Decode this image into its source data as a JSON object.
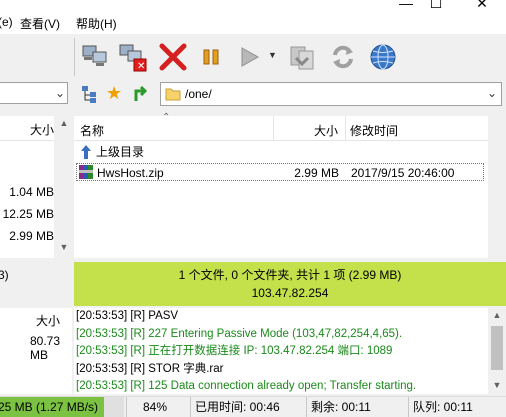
{
  "window": {
    "minimize": "—",
    "maximize": "☐",
    "close": "✕"
  },
  "menu": {
    "view": "查看(V)",
    "prev": "(e)",
    "help": "帮助(H)"
  },
  "address": {
    "path": "/one/"
  },
  "local": {
    "size_header": "大小",
    "sizes": [
      "1.04 MB",
      "12.25 MB",
      "2.99 MB"
    ],
    "status": "3)"
  },
  "remote": {
    "col_name": "名称",
    "col_size": "大小",
    "col_modified": "修改时间",
    "parent_dir": "上级目录",
    "files": [
      {
        "name": "HwsHost.zip",
        "size": "2.99 MB",
        "modified": "2017/9/15 20:46:00"
      }
    ],
    "status_line1": "1 个文件, 0 个文件夹, 共计 1 项 (2.99 MB)",
    "status_line2": "103.47.82.254"
  },
  "queue": {
    "size_header": "大小",
    "size_value": "80.73 MB"
  },
  "log": [
    {
      "time": "[20:53:53]",
      "tag": "[R]",
      "text": "PASV",
      "color": "#000000"
    },
    {
      "time": "[20:53:53]",
      "tag": "[R]",
      "text": "227 Entering Passive Mode (103,47,82,254,4,65).",
      "color": "#1a8a1a"
    },
    {
      "time": "[20:53:53]",
      "tag": "[R]",
      "text": "正在打开数据连接 IP: 103.47.82.254 端口: 1089",
      "color": "#1a8a1a"
    },
    {
      "time": "[20:53:53]",
      "tag": "[R]",
      "text": "STOR 字典.rar",
      "color": "#000000"
    },
    {
      "time": "[20:53:53]",
      "tag": "[R]",
      "text": "125 Data connection already open; Transfer starting.",
      "color": "#1a8a1a"
    }
  ],
  "statusbar": {
    "transfer": "25 MB (1.27 MB/s)",
    "percent": "84%",
    "progress": 0.84,
    "elapsed": "已用时间: 00:46",
    "remaining": "剩余: 00:11",
    "queue": "队列: 00:11"
  },
  "colors": {
    "green_bar": "#c4e04a",
    "log_green": "#1a8a1a",
    "progress_green": "#7cc242"
  },
  "icons": {
    "connect": "computers-icon",
    "disconnect": "disconnect-icon",
    "stop": "red-x-icon",
    "pause": "pause-icon",
    "play": "play-icon",
    "reconnect": "reconnect-icon",
    "refresh": "refresh-icon",
    "web": "globe-icon",
    "tree": "tree-icon",
    "favorite": "star-icon",
    "up": "green-up-arrow-icon",
    "folder": "folder-icon"
  }
}
